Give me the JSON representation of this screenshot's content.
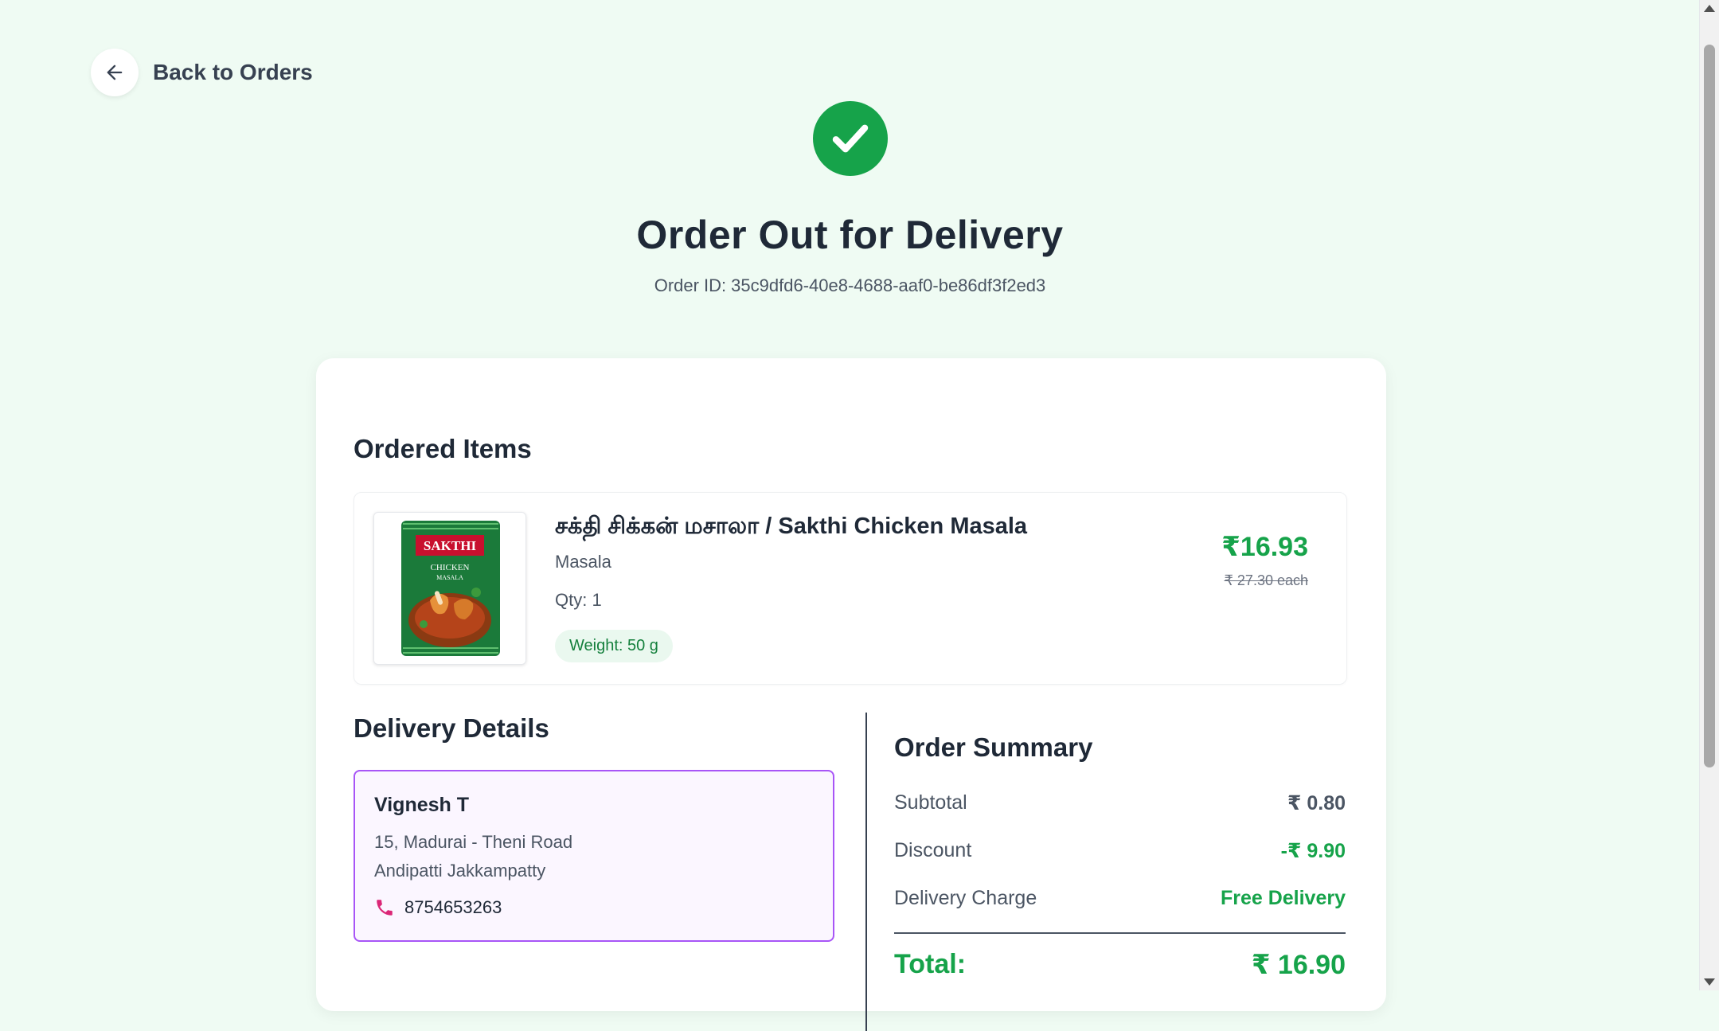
{
  "nav": {
    "back_label": "Back to Orders"
  },
  "header": {
    "title": "Order Out for Delivery",
    "order_id_label": "Order ID:",
    "order_id": "35c9dfd6-40e8-4688-aaf0-be86df3f2ed3"
  },
  "items_section": {
    "title": "Ordered Items",
    "items": [
      {
        "name": "சக்தி சிக்கன் மசாலா / Sakthi Chicken Masala",
        "category": "Masala",
        "qty": "Qty: 1",
        "weight": "Weight: 50 g",
        "price": "₹16.93",
        "old_price": "₹ 27.30 each",
        "package_brand": "SAKTHI",
        "package_line1": "CHICKEN",
        "package_line2": "MASALA"
      }
    ]
  },
  "delivery": {
    "title": "Delivery Details",
    "name": "Vignesh T",
    "address_line1": "15, Madurai - Theni Road",
    "address_line2": "Andipatti Jakkampatty",
    "phone": "8754653263"
  },
  "summary": {
    "title": "Order Summary",
    "subtotal_label": "Subtotal",
    "subtotal": "₹ 0.80",
    "discount_label": "Discount",
    "discount": "-₹ 9.90",
    "delivery_label": "Delivery Charge",
    "delivery_value": "Free Delivery",
    "total_label": "Total:",
    "total": "₹ 16.90"
  },
  "colors": {
    "background": "#effbf3",
    "accent_green": "#16a34a",
    "address_border": "#a855f7",
    "phone_icon": "#db2777"
  }
}
